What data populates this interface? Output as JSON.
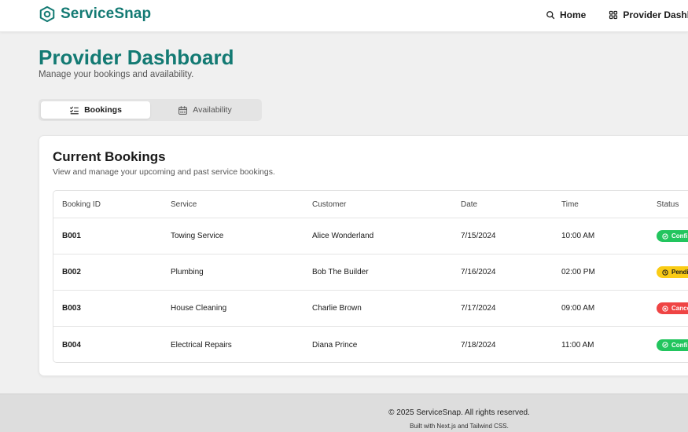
{
  "brand": {
    "name": "ServiceSnap",
    "color": "#137a73"
  },
  "nav": {
    "home": {
      "label": "Home",
      "icon": "search-icon"
    },
    "provider_dashboard": {
      "label": "Provider Dashboard",
      "icon": "grid-icon"
    }
  },
  "page": {
    "title": "Provider Dashboard",
    "subtitle": "Manage your bookings and availability."
  },
  "tabs": [
    {
      "label": "Bookings",
      "icon": "list-check-icon",
      "active": true
    },
    {
      "label": "Availability",
      "icon": "calendar-icon",
      "active": false
    }
  ],
  "bookings": {
    "title": "Current Bookings",
    "description": "View and manage your upcoming and past service bookings.",
    "columns": [
      "Booking ID",
      "Service",
      "Customer",
      "Date",
      "Time",
      "Status"
    ],
    "rows": [
      {
        "id": "B001",
        "service": "Towing Service",
        "customer": "Alice Wonderland",
        "date": "7/15/2024",
        "time": "10:00 AM",
        "status": "Confirmed",
        "status_color": "#22c55e"
      },
      {
        "id": "B002",
        "service": "Plumbing",
        "customer": "Bob The Builder",
        "date": "7/16/2024",
        "time": "02:00 PM",
        "status": "Pending",
        "status_color": "#facc15"
      },
      {
        "id": "B003",
        "service": "House Cleaning",
        "customer": "Charlie Brown",
        "date": "7/17/2024",
        "time": "09:00 AM",
        "status": "Cancelled",
        "status_color": "#ef4444"
      },
      {
        "id": "B004",
        "service": "Electrical Repairs",
        "customer": "Diana Prince",
        "date": "7/18/2024",
        "time": "11:00 AM",
        "status": "Confirmed",
        "status_color": "#22c55e"
      }
    ]
  },
  "footer": {
    "copyright": "© 2025 ServiceSnap. All rights reserved.",
    "built_with": "Built with Next.js and Tailwind CSS."
  }
}
